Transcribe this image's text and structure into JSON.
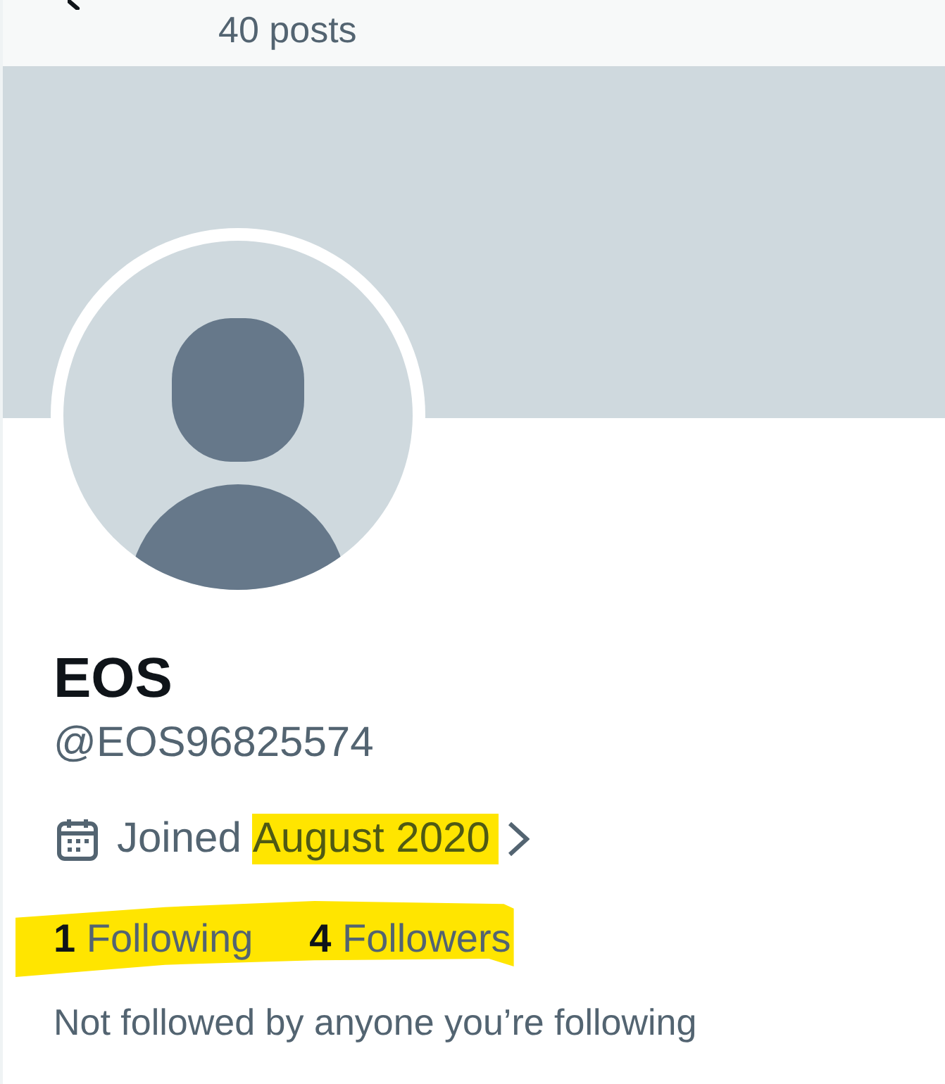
{
  "header": {
    "posts_count": "40 posts"
  },
  "profile": {
    "name": "EOS",
    "handle": "@EOS96825574",
    "joined": {
      "label": "Joined",
      "date": "August 2020",
      "highlighted": true
    },
    "stats": {
      "highlighted": true,
      "items": [
        {
          "count": "1",
          "label": "Following"
        },
        {
          "count": "4",
          "label": "Followers"
        }
      ]
    },
    "followed_by": "Not followed by anyone you’re following"
  }
}
